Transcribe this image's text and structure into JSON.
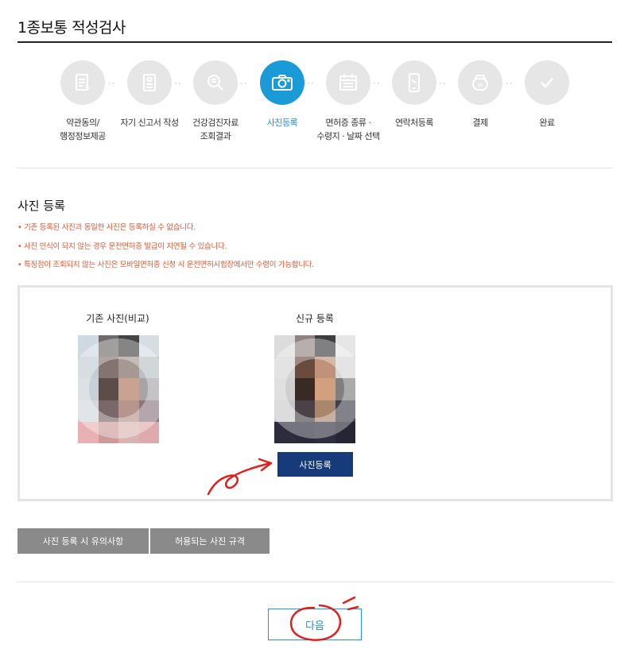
{
  "page": {
    "title": "1종보통 적성검사"
  },
  "steps": [
    {
      "label": "약관동의/\n행정정보제공",
      "icon": "document-icon",
      "active": false
    },
    {
      "label": "자기 신고서 작성",
      "icon": "form-icon",
      "active": false
    },
    {
      "label": "건강검진자료\n조회결과",
      "icon": "search-icon",
      "active": false
    },
    {
      "label": "사진등록",
      "icon": "camera-icon",
      "active": true
    },
    {
      "label": "면허증 종류 ·\n수령지 · 날짜 선택",
      "icon": "calendar-icon",
      "active": false
    },
    {
      "label": "연락처등록",
      "icon": "phone-icon",
      "active": false
    },
    {
      "label": "결제",
      "icon": "wallet-icon",
      "active": false
    },
    {
      "label": "완료",
      "icon": "check-icon",
      "active": false
    }
  ],
  "section": {
    "title": "사진 등록",
    "notices": [
      "• 기존 등록된 사진과 동일한 사진은 등록하실 수 없습니다.",
      "• 사진 인식이 되지 않는 경우 운전면허증 발급이 지연될 수 있습니다.",
      "• 특징점이 조회되지 않는 사진은 모바일면허증 신청 시 운전면허시험장에서만 수령이 가능합니다."
    ]
  },
  "photos": {
    "existing_title": "기존 사진(비교)",
    "new_title": "신규 등록",
    "register_button": "사진등록"
  },
  "buttons": {
    "caution": "사진 등록 시 유의사항",
    "spec": "허용되는 사진 규격",
    "next": "다음"
  },
  "colors": {
    "accent": "#1a9ad6",
    "notice": "#e2562f",
    "navy": "#173a7a",
    "gray_button": "#8a8a8a",
    "annotation": "#e0201e"
  }
}
